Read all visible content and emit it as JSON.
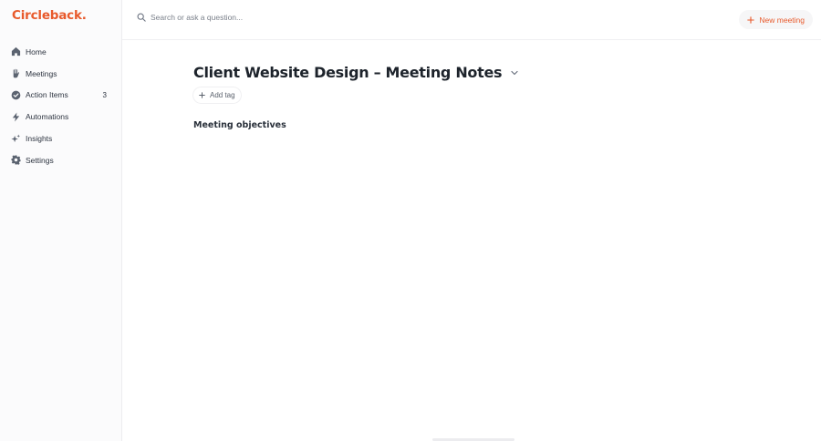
{
  "app": {
    "logo_text": "Circleback",
    "logo_dot": ".",
    "accent_color": "#e85a2c"
  },
  "sidebar": {
    "items": [
      {
        "label": "Home",
        "icon": "home-icon"
      },
      {
        "label": "Meetings",
        "icon": "meetings-icon"
      },
      {
        "label": "Action Items",
        "icon": "check-circle-icon",
        "count": "3"
      },
      {
        "label": "Automations",
        "icon": "lightning-icon"
      },
      {
        "label": "Insights",
        "icon": "sparkle-icon"
      },
      {
        "label": "Settings",
        "icon": "gear-icon"
      }
    ]
  },
  "header": {
    "search_placeholder": "Search or ask a question...",
    "new_meeting_label": "New meeting"
  },
  "main": {
    "title": "Client Website Design – Meeting Notes",
    "add_tag_label": "Add tag",
    "section_heading": "Meeting objectives"
  }
}
